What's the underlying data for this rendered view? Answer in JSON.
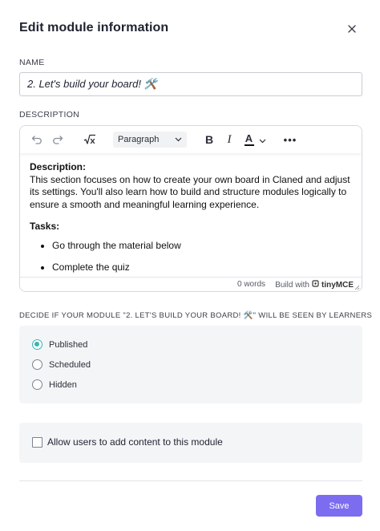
{
  "modal": {
    "title": "Edit module information",
    "close_icon": "close-icon"
  },
  "name_field": {
    "label": "NAME",
    "value": "2. Let's build your board! 🛠️"
  },
  "description": {
    "label": "DESCRIPTION",
    "toolbar": {
      "undo_icon": "undo-icon",
      "redo_icon": "redo-icon",
      "math_icon": "math-formula-icon",
      "block_format": "Paragraph",
      "bold_label": "B",
      "italic_label": "I",
      "text_color_label": "A",
      "more_icon": "more-icon",
      "more_label": "•••"
    },
    "content": {
      "heading": "Description:",
      "paragraph": "This section focuses on how to create your own board in Claned and adjust its settings. You'll also learn how to build and structure modules logically to ensure a smooth and meaningful learning experience.",
      "tasks_heading": "Tasks:",
      "tasks": [
        "Go through the material below",
        "Complete the quiz"
      ]
    },
    "status": {
      "word_count": "0 words",
      "build_with": "Build with",
      "brand": "tinyMCE"
    }
  },
  "visibility": {
    "label": "DECIDE IF YOUR MODULE \"2. LET'S BUILD YOUR BOARD! 🛠️\" WILL BE SEEN BY LEARNERS",
    "options": [
      {
        "label": "Published",
        "selected": true
      },
      {
        "label": "Scheduled",
        "selected": false
      },
      {
        "label": "Hidden",
        "selected": false
      }
    ],
    "accent_color": "#3bb4b0"
  },
  "allow_content": {
    "label": "Allow users to add content to this module",
    "checked": false
  },
  "footer": {
    "save_label": "Save",
    "save_color": "#7b6cf0"
  }
}
